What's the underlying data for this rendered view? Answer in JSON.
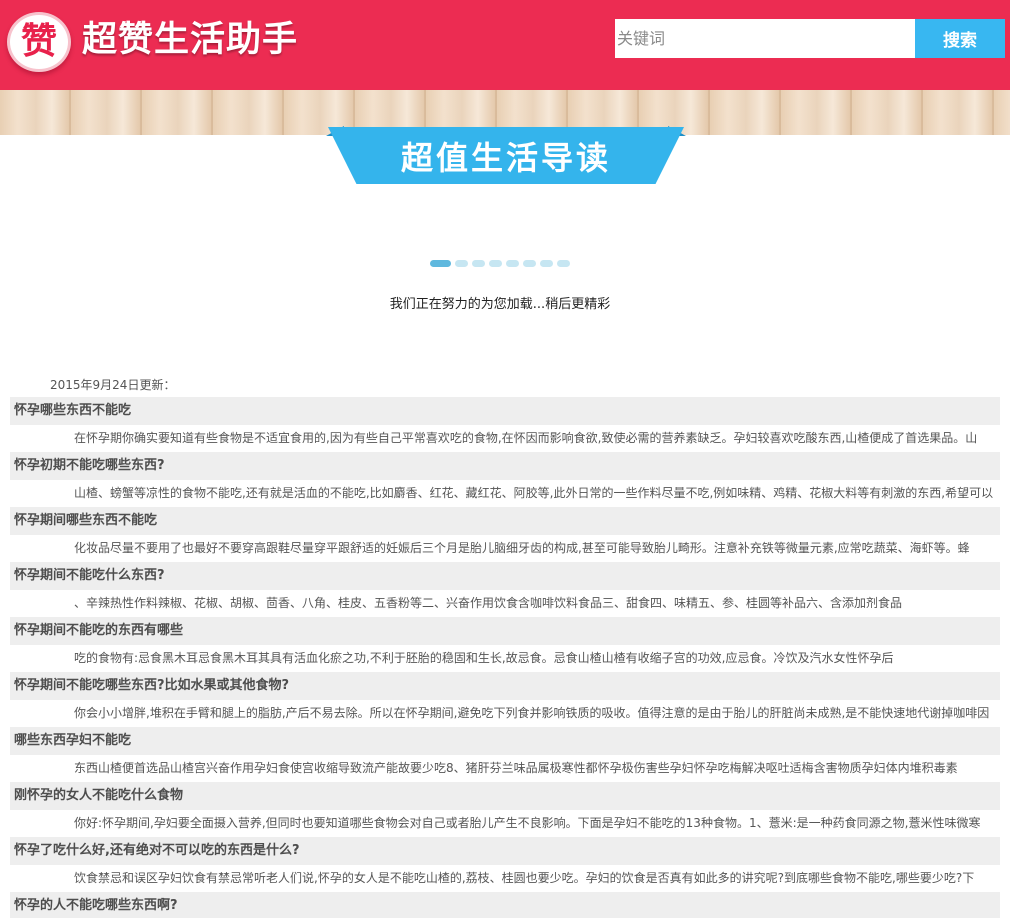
{
  "header": {
    "logo_char": "赞",
    "site_title": "超赞生活助手",
    "search_placeholder": "关键词",
    "search_button": "搜索",
    "brand_color": "#ec2c52",
    "accent_color": "#38b7f1"
  },
  "banner": {
    "title": "超值生活导读"
  },
  "carousel": {
    "dot_count": 8,
    "active_index": 0
  },
  "loading_text": "我们正在努力的为您加载...稍后更精彩",
  "update_date": "2015年9月24日更新：",
  "articles": [
    {
      "title": "怀孕哪些东西不能吃",
      "desc": "在怀孕期你确实要知道有些食物是不适宜食用的,因为有些自己平常喜欢吃的食物,在怀因而影响食欲,致使必需的营养素缺乏。孕妇较喜欢吃酸东西,山楂便成了首选果品。山"
    },
    {
      "title": "怀孕初期不能吃哪些东西?",
      "desc": "山楂、螃蟹等凉性的食物不能吃,还有就是活血的不能吃,比如麝香、红花、藏红花、阿胶等,此外日常的一些作料尽量不吃,例如味精、鸡精、花椒大料等有刺激的东西,希望可以"
    },
    {
      "title": "怀孕期间哪些东西不能吃",
      "desc": "化妆品尽量不要用了也最好不要穿高跟鞋尽量穿平跟舒适的妊娠后三个月是胎儿脑细牙齿的构成,甚至可能导致胎儿畸形。注意补充铁等微量元素,应常吃蔬菜、海虾等。蜂"
    },
    {
      "title": "怀孕期间不能吃什么东西?",
      "desc": "、辛辣热性作料辣椒、花椒、胡椒、茴香、八角、桂皮、五香粉等二、兴奋作用饮食含咖啡饮料食品三、甜食四、味精五、参、桂圆等补品六、含添加剂食品"
    },
    {
      "title": "怀孕期间不能吃的东西有哪些",
      "desc": "吃的食物有:忌食黑木耳忌食黑木耳其具有活血化瘀之功,不利于胚胎的稳固和生长,故忌食。忌食山楂山楂有收缩子宫的功效,应忌食。冷饮及汽水女性怀孕后"
    },
    {
      "title": "怀孕期间不能吃哪些东西?比如水果或其他食物?",
      "desc": "你会小小增胖,堆积在手臂和腿上的脂肪,产后不易去除。所以在怀孕期间,避免吃下列食并影响铁质的吸收。值得注意的是由于胎儿的肝脏尚未成熟,是不能快速地代谢掉咖啡因"
    },
    {
      "title": "哪些东西孕妇不能吃",
      "desc": "东西山楂便首选品山楂宫兴奋作用孕妇食使宫收缩导致流产能故要少吃8、猪肝芬兰味品属极寒性都怀孕极伤害些孕妇怀孕吃梅解决呕吐适梅含害物质孕妇体内堆积毒素"
    },
    {
      "title": "刚怀孕的女人不能吃什么食物",
      "desc": "你好:怀孕期间,孕妇要全面摄入营养,但同时也要知道哪些食物会对自己或者胎儿产生不良影响。下面是孕妇不能吃的13种食物。1、薏米:是一种药食同源之物,薏米性味微寒"
    },
    {
      "title": "怀孕了吃什么好,还有绝对不可以吃的东西是什么?",
      "desc": "饮食禁忌和误区孕妇饮食有禁忌常听老人们说,怀孕的女人是不能吃山楂的,荔枝、桂圆也要少吃。孕妇的饮食是否真有如此多的讲究呢?到底哪些食物不能吃,哪些要少吃?下"
    },
    {
      "title": "怀孕的人不能吃哪些东西啊?",
      "desc": ""
    }
  ]
}
